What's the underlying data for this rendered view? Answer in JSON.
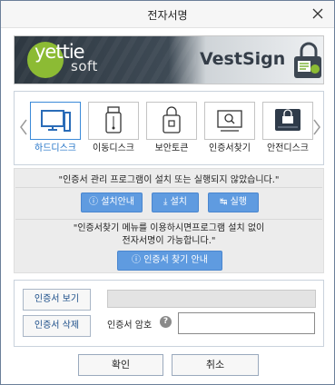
{
  "window": {
    "title": "전자서명"
  },
  "banner": {
    "logo_text": "yettie",
    "logo_sub": "soft",
    "product": "VestSign"
  },
  "devices": [
    {
      "label": "하드디스크",
      "icon": "hard-disk-icon",
      "selected": true
    },
    {
      "label": "이동디스크",
      "icon": "usb-drive-icon",
      "selected": false
    },
    {
      "label": "보안토큰",
      "icon": "security-token-icon",
      "selected": false
    },
    {
      "label": "인증서찾기",
      "icon": "find-cert-icon",
      "selected": false
    },
    {
      "label": "안전디스크",
      "icon": "secure-disk-icon",
      "selected": false
    }
  ],
  "notice": {
    "message1": "\"인증서 관리 프로그램이 설치 또는 실행되지 않았습니다.\"",
    "install_guide": "설치안내",
    "install": "설치",
    "run": "실행",
    "message2_line1": "\"인증서찾기 메뉴를 이용하시면프로그램 설치 없이",
    "message2_line2": "전자서명이 가능합니다.\"",
    "find_guide": "인증서 찾기 안내"
  },
  "cert": {
    "view": "인증서 보기",
    "delete": "인증서 삭제",
    "path_value": "",
    "password_label": "인증서 암호",
    "help": "?",
    "password_value": ""
  },
  "footer": {
    "ok": "확인",
    "cancel": "취소"
  },
  "colors": {
    "accent": "#5f9be0",
    "selected_border": "#3b8ad8",
    "logo_green": "#8cbb34"
  }
}
